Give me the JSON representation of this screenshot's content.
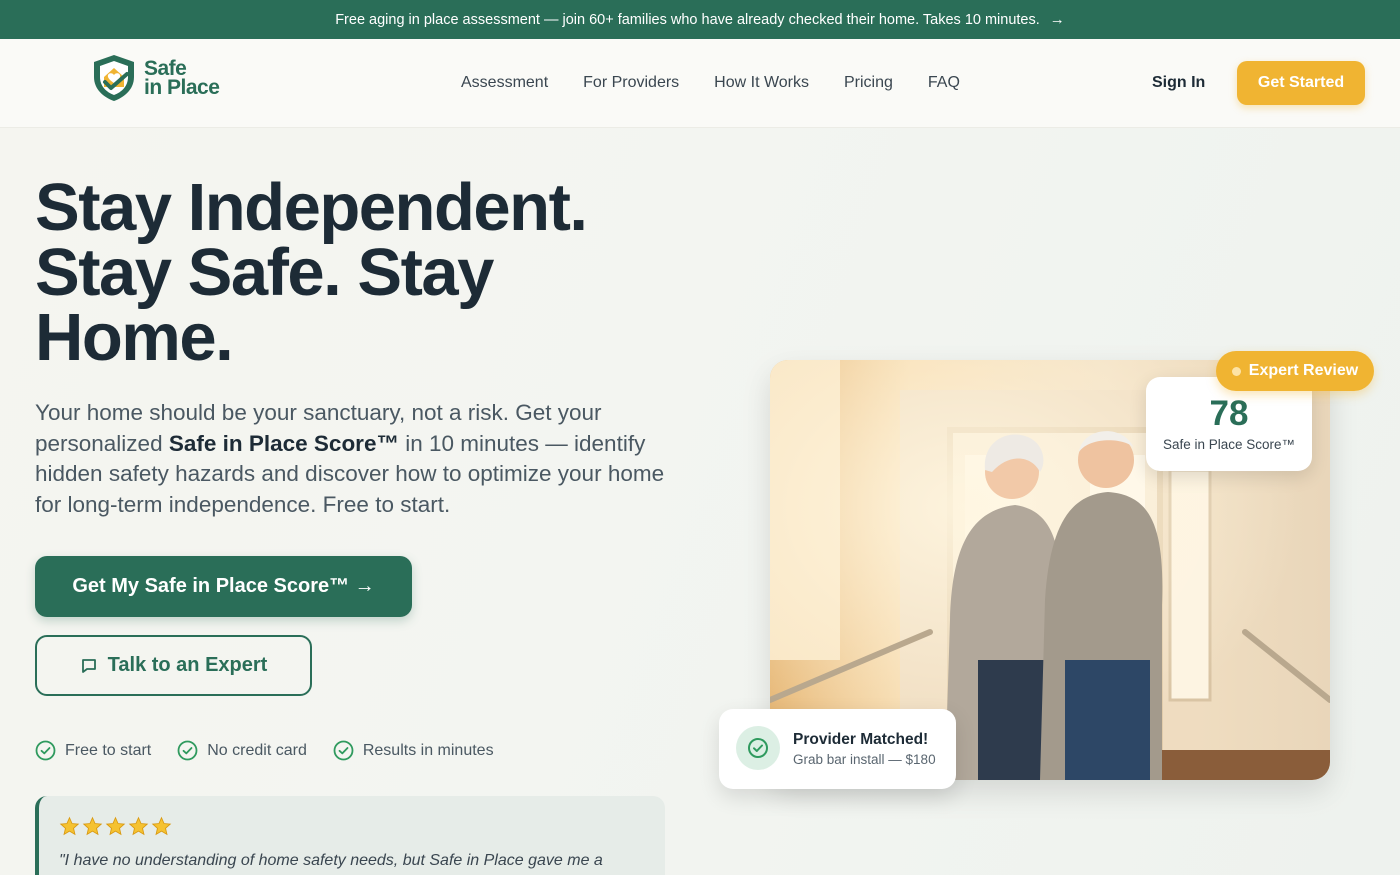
{
  "announcement": {
    "text": "Free aging in place assessment — join 60+ families who have already checked their home. Takes 10 minutes.",
    "arrow": "→"
  },
  "brand": {
    "line1": "Safe",
    "line2": "in Place"
  },
  "nav": {
    "links": [
      "Assessment",
      "For Providers",
      "How It Works",
      "Pricing",
      "FAQ"
    ],
    "sign_in": "Sign In",
    "get_started": "Get Started"
  },
  "hero": {
    "title_line1": "Stay Independent.",
    "title_line2": "Stay Safe. Stay",
    "title_line3": "Home.",
    "sub_before": "Your home should be your sanctuary, not a risk. Get your personalized ",
    "sub_bold": "Safe in Place Score™",
    "sub_after": " in 10 minutes — identify hidden safety hazards and discover how to optimize your home for long-term independence. Free to start.",
    "primary_cta": "Get My Safe in Place Score™ →",
    "secondary_cta": "Talk to an Expert",
    "checks": [
      "Free to start",
      "No credit card",
      "Results in minutes"
    ]
  },
  "testimonial": {
    "stars": 5,
    "quote": "\"I have no understanding of home safety needs, but Safe in Place gave me a"
  },
  "score_card": {
    "value": "78",
    "label": "Safe in Place Score™"
  },
  "expert_badge": {
    "label": "Expert Review"
  },
  "provider_card": {
    "title": "Provider Matched!",
    "detail": "Grab bar install — $180"
  },
  "colors": {
    "brand_green": "#2a6e58",
    "accent_gold": "#f0b432"
  }
}
